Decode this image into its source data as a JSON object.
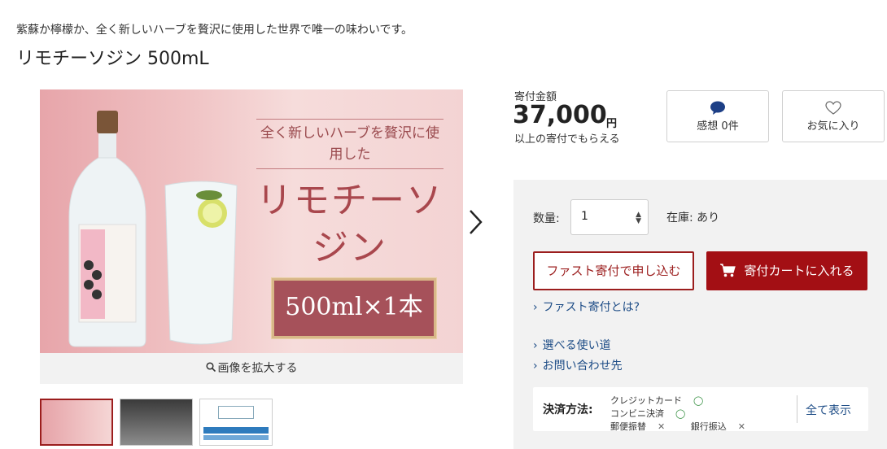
{
  "product": {
    "subtitle": "紫蘇か檸檬か、全く新しいハーブを贅沢に使用した世界で唯一の味わいです。",
    "title": "リモチーソジン 500mL"
  },
  "image": {
    "banner_line": "全く新しいハーブを贅沢に使用した",
    "banner_name": "リモチーソジン",
    "banner_qty": "500ml×1本",
    "zoom_label": "画像を拡大する"
  },
  "price": {
    "label": "寄付金額",
    "amount": "37,000",
    "unit": "円",
    "note": "以上の寄付でもらえる"
  },
  "actions": {
    "review_label": "感想 0件",
    "favorite_label": "お気に入り"
  },
  "purchase": {
    "qty_label": "数量:",
    "qty_value": "1",
    "stock_label": "在庫: あり",
    "fast_button": "ファスト寄付で申し込む",
    "cart_button": "寄付カートに入れる",
    "links": [
      "ファスト寄付とは?",
      "選べる使い道",
      "お問い合わせ先"
    ]
  },
  "payment": {
    "label": "決済方法:",
    "methods": [
      {
        "name": "クレジットカード",
        "mark": "◯"
      },
      {
        "name": "コンビニ決済",
        "mark": "◯"
      },
      {
        "name": "郵便振替",
        "mark": "✕"
      },
      {
        "name": "銀行振込",
        "mark": "✕"
      }
    ],
    "show_all": "全て表示"
  },
  "colors": {
    "accent": "#a30f14",
    "link": "#1d4c86",
    "available": "#2e8b3a"
  }
}
